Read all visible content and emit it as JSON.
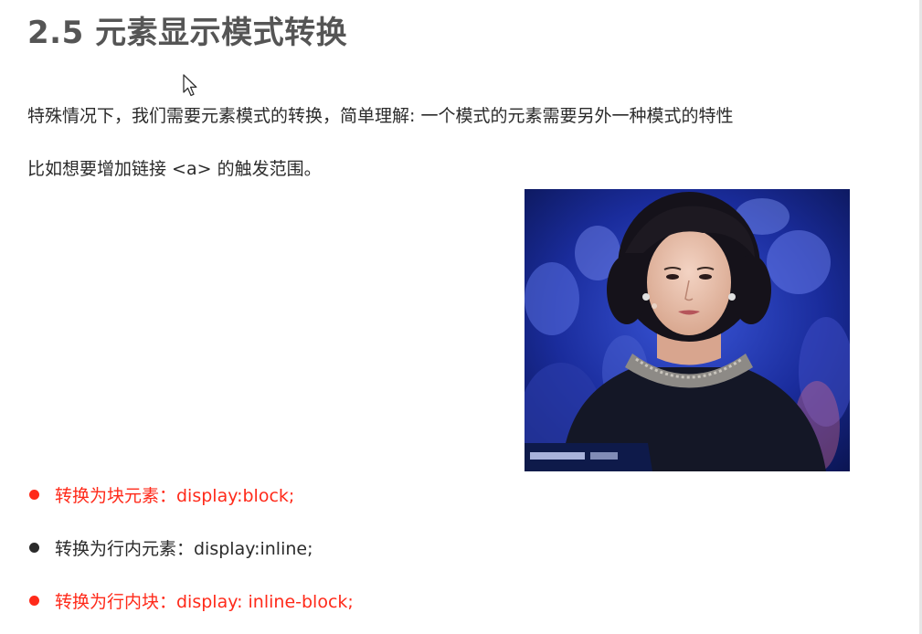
{
  "slide": {
    "title": "2.5 元素显示模式转换",
    "paragraphs": [
      "特殊情况下，我们需要元素模式的转换，简单理解: 一个模式的元素需要另外一种模式的特性",
      "比如想要增加链接 <a> 的触发范围。"
    ],
    "bullets": [
      {
        "text": "转换为块元素：display:block;",
        "color": "#ff2a1a"
      },
      {
        "text": "转换为行内元素：display:inline;",
        "color": "#2b2b2b"
      },
      {
        "text": "转换为行内块：display: inline-block;",
        "color": "#ff2a1a"
      }
    ]
  },
  "icons": {
    "cursor": "mouse-pointer-icon"
  }
}
